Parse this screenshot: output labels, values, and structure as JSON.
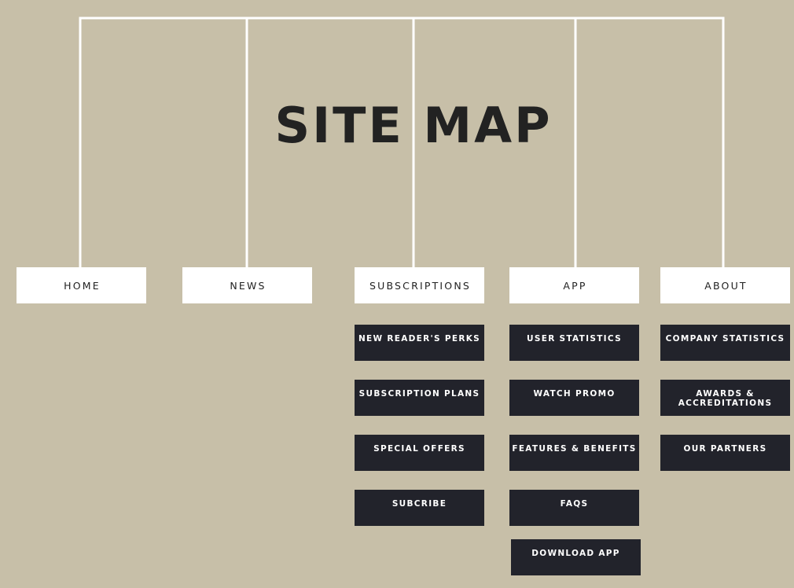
{
  "title": "SITE MAP",
  "colors": {
    "background": "#c7bfa8",
    "primary_box": "#ffffff",
    "primary_text": "#222222",
    "secondary_box": "#22232b",
    "secondary_text": "#ffffff",
    "connector": "#ffffff",
    "title": "#222222"
  },
  "sections": [
    {
      "label": "HOME",
      "children": []
    },
    {
      "label": "NEWS",
      "children": []
    },
    {
      "label": "SUBSCRIPTIONS",
      "children": [
        "NEW READER'S PERKS",
        "SUBSCRIPTION PLANS",
        "SPECIAL OFFERS",
        "SUBCRIBE"
      ]
    },
    {
      "label": "APP",
      "children": [
        "USER STATISTICS",
        "WATCH PROMO",
        "FEATURES & BENEFITS",
        "FAQS",
        "DOWNLOAD APP"
      ]
    },
    {
      "label": "ABOUT",
      "children": [
        "COMPANY STATISTICS",
        "AWARDS &\nACCREDITATIONS",
        "OUR PARTNERS"
      ]
    }
  ]
}
